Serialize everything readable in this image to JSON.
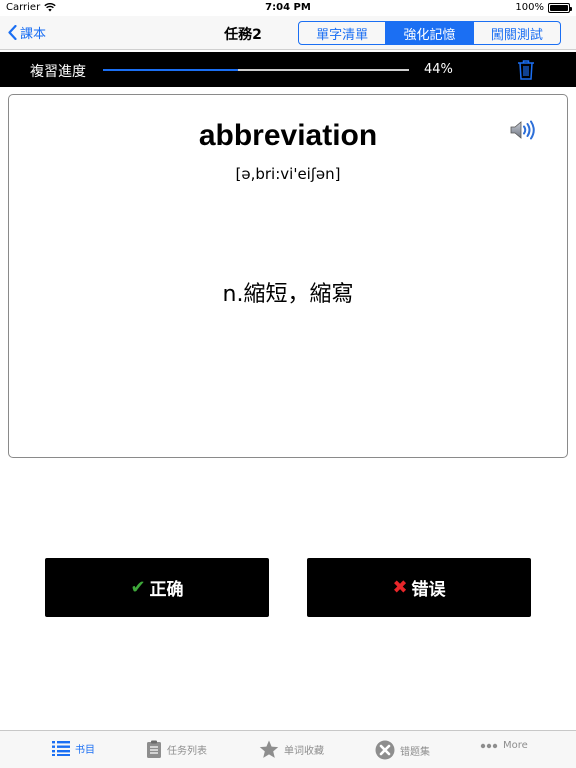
{
  "status_bar": {
    "carrier": "Carrier",
    "time": "7:04 PM",
    "battery": "100%"
  },
  "nav": {
    "back_label": "課本",
    "title": "任務2",
    "segments": [
      {
        "label": "單字清單",
        "active": false
      },
      {
        "label": "強化記憶",
        "active": true
      },
      {
        "label": "闖關測試",
        "active": false
      }
    ]
  },
  "progress": {
    "label": "複習進度",
    "percent_text": "44%",
    "value": 0.44
  },
  "card": {
    "word": "abbreviation",
    "phonetic": "[ə,bri:vi'eiʃən]",
    "meaning": "n.縮短，縮寫"
  },
  "buttons": {
    "correct_label": "正确",
    "wrong_label": "错误"
  },
  "tabs": [
    {
      "label": "书目",
      "icon": "list-icon",
      "active": true
    },
    {
      "label": "任务列表",
      "icon": "clipboard-icon",
      "active": false
    },
    {
      "label": "单词收藏",
      "icon": "star-icon",
      "active": false
    },
    {
      "label": "错题集",
      "icon": "x-circle-icon",
      "active": false
    },
    {
      "label": "More",
      "icon": "more-icon",
      "active": false
    }
  ],
  "colors": {
    "accent": "#1b6ff3",
    "correct": "#3ea83a",
    "wrong": "#e8262a",
    "bar_bg": "#000000"
  }
}
